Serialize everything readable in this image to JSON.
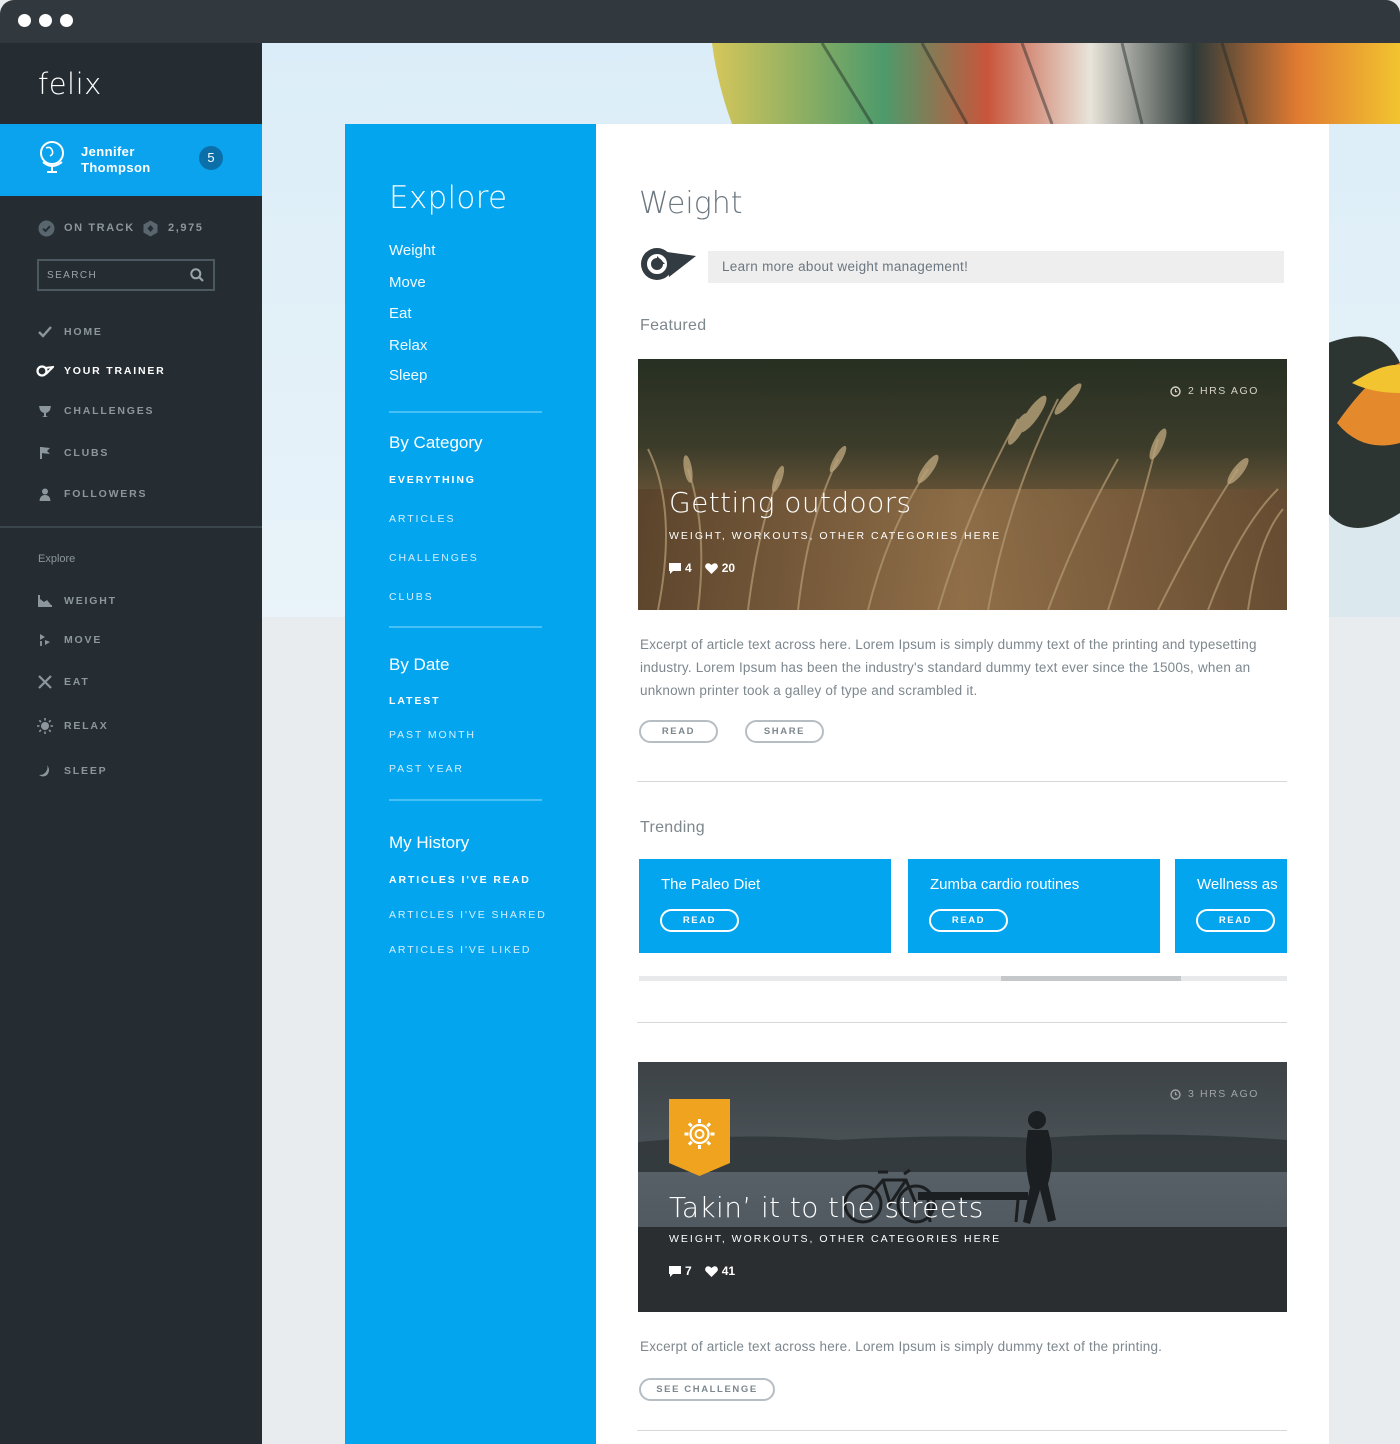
{
  "app": {
    "name": "felix"
  },
  "user": {
    "first_name": "Jennifer",
    "last_name": "Thompson",
    "notifications": "5"
  },
  "status": {
    "track_label": "ON TRACK",
    "points": "2,975"
  },
  "search": {
    "placeholder": "SEARCH"
  },
  "nav": {
    "items": [
      {
        "label": "HOME",
        "icon": "check-icon"
      },
      {
        "label": "YOUR TRAINER",
        "icon": "trainer-icon",
        "active": true
      },
      {
        "label": "CHALLENGES",
        "icon": "trophy-icon"
      },
      {
        "label": "CLUBS",
        "icon": "flag-icon"
      },
      {
        "label": "FOLLOWERS",
        "icon": "person-icon"
      }
    ],
    "explore_label": "Explore",
    "explore_items": [
      {
        "label": "WEIGHT",
        "icon": "chart-icon"
      },
      {
        "label": "MOVE",
        "icon": "move-icon"
      },
      {
        "label": "EAT",
        "icon": "cutlery-icon"
      },
      {
        "label": "RELAX",
        "icon": "sun-icon"
      },
      {
        "label": "SLEEP",
        "icon": "moon-icon"
      }
    ]
  },
  "explore": {
    "title": "Explore",
    "links": [
      "Weight",
      "Move",
      "Eat",
      "Relax",
      "Sleep"
    ],
    "by_category": {
      "title": "By Category",
      "items": [
        "EVERYTHING",
        "ARTICLES",
        "CHALLENGES",
        "CLUBS"
      ]
    },
    "by_date": {
      "title": "By Date",
      "items": [
        "LATEST",
        "PAST MONTH",
        "PAST YEAR"
      ]
    },
    "my_history": {
      "title": "My History",
      "items": [
        "ARTICLES I'VE READ",
        "ARTICLES I'VE SHARED",
        "ARTICLES I'VE LIKED"
      ]
    }
  },
  "main": {
    "title": "Weight",
    "trainer_message": "Learn more about weight management!",
    "featured_label": "Featured",
    "featured": {
      "time_ago": "2 HRS AGO",
      "title": "Getting outdoors",
      "categories": "WEIGHT, WORKOUTS, OTHER CATEGORIES HERE",
      "comments": "4",
      "likes": "20",
      "excerpt": "Excerpt of article text across here. Lorem Ipsum is simply dummy text of the printing and typesetting industry. Lorem Ipsum has been the industry's standard dummy text ever since the 1500s, when an unknown printer took a galley of type and scrambled it.",
      "read_label": "READ",
      "share_label": "SHARE"
    },
    "trending_label": "Trending",
    "trending": [
      {
        "title": "The Paleo Diet",
        "read_label": "READ"
      },
      {
        "title": "Zumba cardio routines",
        "read_label": "READ"
      },
      {
        "title": "Wellness as",
        "read_label": "READ"
      }
    ],
    "challenge": {
      "time_ago": "3 HRS AGO",
      "title": "Takin’ it to the streets",
      "categories": "WEIGHT, WORKOUTS, OTHER CATEGORIES HERE",
      "comments": "7",
      "likes": "41",
      "excerpt": "Excerpt of article text across here. Lorem Ipsum is simply dummy text of the printing.",
      "cta_label": "SEE CHALLENGE"
    }
  },
  "colors": {
    "accent": "#04a5ef",
    "sidebar": "#252d33",
    "badge": "#f0a31e"
  }
}
